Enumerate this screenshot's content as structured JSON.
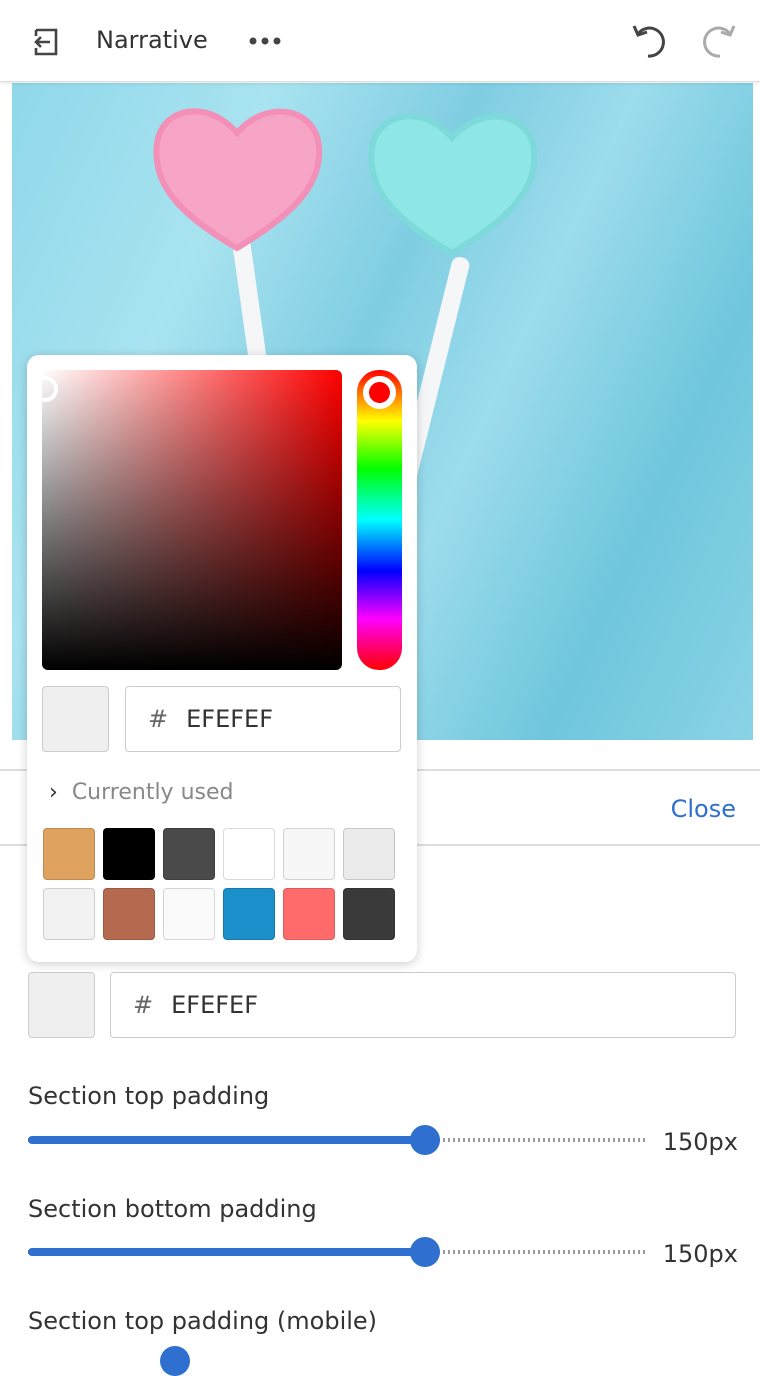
{
  "header": {
    "title": "Narrative",
    "back_icon": "exit-icon",
    "more_icon": "more-horizontal-icon",
    "undo_icon": "undo-icon",
    "redo_icon": "redo-icon"
  },
  "panel": {
    "close_label": "Close"
  },
  "color_picker": {
    "hue_color": "#FF0000",
    "hex_symbol": "#",
    "hex_value": "EFEFEF",
    "preview_color": "#EFEFEF",
    "currently_used_label": "Currently used",
    "swatches": [
      "#DFA35F",
      "#000000",
      "#4A4A4A",
      "#FFFFFF",
      "#F7F7F7",
      "#EBEBEB",
      "#F2F2F2",
      "#B56A50",
      "#FAFAFA",
      "#1A8FC9",
      "#FF6B6B",
      "#3A3A3A"
    ]
  },
  "background_color": {
    "hex_symbol": "#",
    "hex_value": "EFEFEF",
    "preview_color": "#EFEFEF"
  },
  "settings": [
    {
      "label": "Section top padding",
      "value": "150px",
      "fraction": 0.64
    },
    {
      "label": "Section bottom padding",
      "value": "150px",
      "fraction": 0.64
    },
    {
      "label": "Section top padding (mobile)"
    }
  ],
  "accent_color": "#2F6FD0"
}
